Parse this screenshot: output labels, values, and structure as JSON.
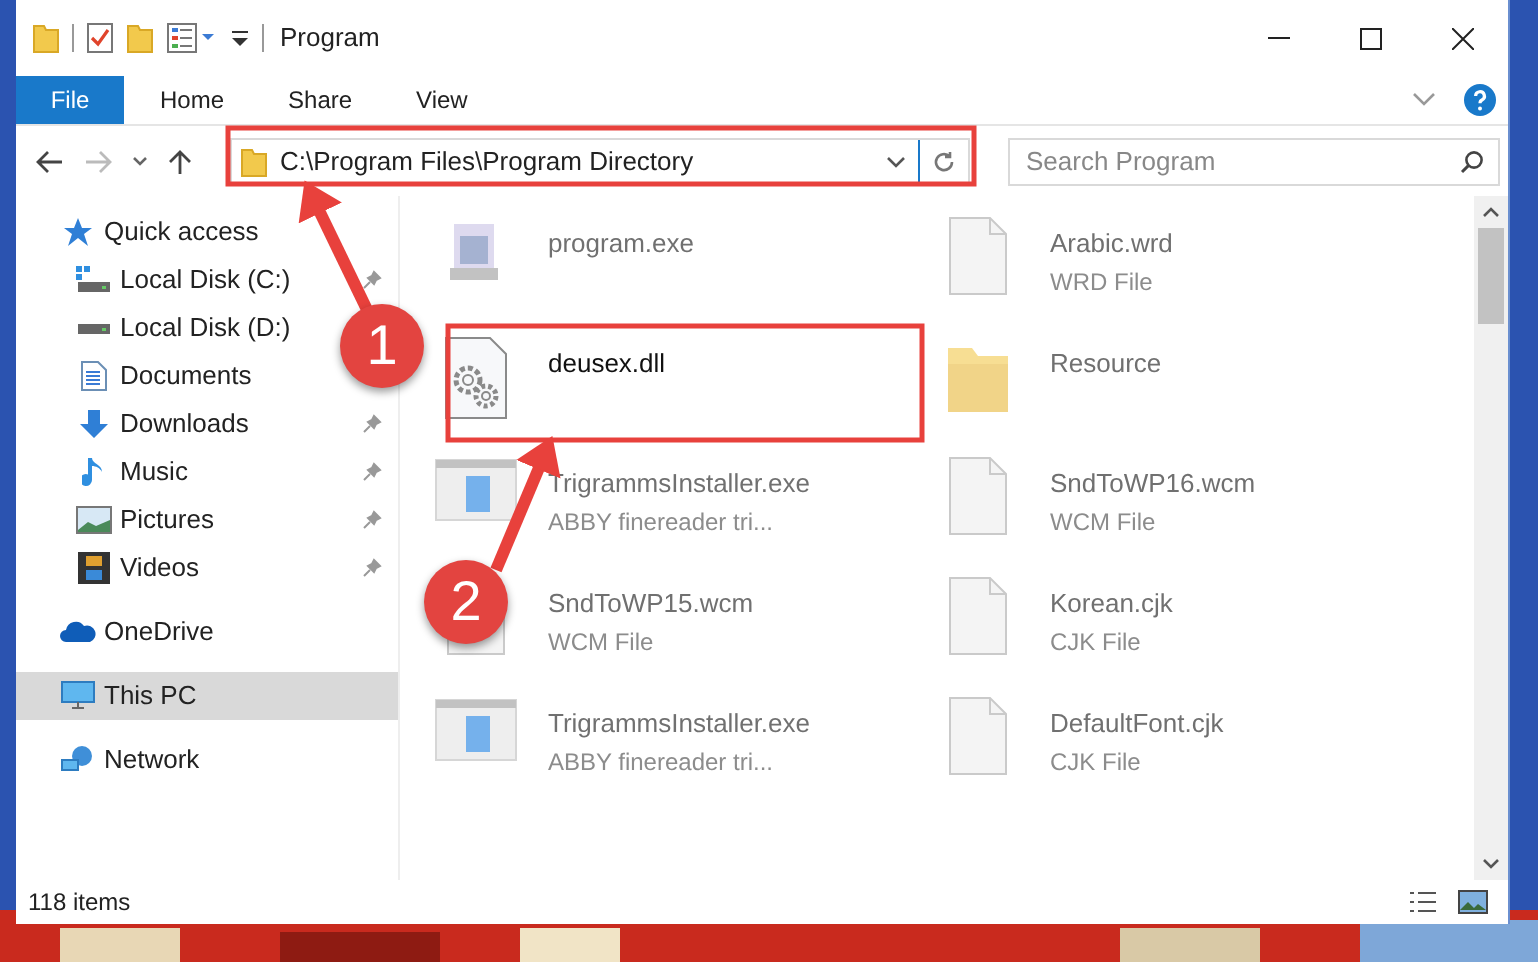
{
  "window": {
    "title": "Program"
  },
  "ribbon_tabs": [
    {
      "label": "File",
      "kind": "file"
    },
    {
      "label": "Home",
      "kind": "tab"
    },
    {
      "label": "Share",
      "kind": "tab"
    },
    {
      "label": "View",
      "kind": "tab"
    }
  ],
  "address": {
    "path": "C:\\Program Files\\Program Directory"
  },
  "search": {
    "placeholder": "Search Program"
  },
  "sidebar": {
    "items": [
      {
        "label": "Quick access",
        "selected": false,
        "children": [
          {
            "label": "Local Disk (C:)",
            "pinned": true
          },
          {
            "label": "Local Disk (D:)"
          },
          {
            "label": "Documents"
          },
          {
            "label": "Downloads",
            "pinned": true
          },
          {
            "label": "Music",
            "pinned": true
          },
          {
            "label": "Pictures",
            "pinned": true
          },
          {
            "label": "Videos",
            "pinned": true
          }
        ]
      },
      {
        "label": "OneDrive",
        "selected": false
      },
      {
        "label": "This PC",
        "selected": true
      },
      {
        "label": "Network",
        "selected": false
      }
    ]
  },
  "files": [
    {
      "name": "program.exe",
      "kind": "app",
      "blurred": true
    },
    {
      "name": "Arabic.wrd",
      "type": "WRD File",
      "kind": "doc",
      "blurred": true
    },
    {
      "name": "deusex.dll",
      "kind": "dll",
      "blurred": false
    },
    {
      "name": "Resource",
      "kind": "folder",
      "blurred": true
    },
    {
      "name": "TrigrammsInstaller.exe",
      "type": "ABBY finereader tri...",
      "kind": "installer",
      "blurred": true
    },
    {
      "name": "SndToWP16.wcm",
      "type": "WCM File",
      "kind": "doc",
      "blurred": true
    },
    {
      "name": "SndToWP15.wcm",
      "type": "WCM File",
      "kind": "doc",
      "blurred": true
    },
    {
      "name": "Korean.cjk",
      "type": "CJK File",
      "kind": "doc",
      "blurred": true
    },
    {
      "name": "TrigrammsInstaller.exe",
      "type": "ABBY finereader tri...",
      "kind": "installer",
      "blurred": true
    },
    {
      "name": "DefaultFont.cjk",
      "type": "CJK File",
      "kind": "doc",
      "blurred": true
    }
  ],
  "status_bar": {
    "count": "118 items"
  },
  "callouts": [
    {
      "number": "1"
    },
    {
      "number": "2"
    }
  ]
}
